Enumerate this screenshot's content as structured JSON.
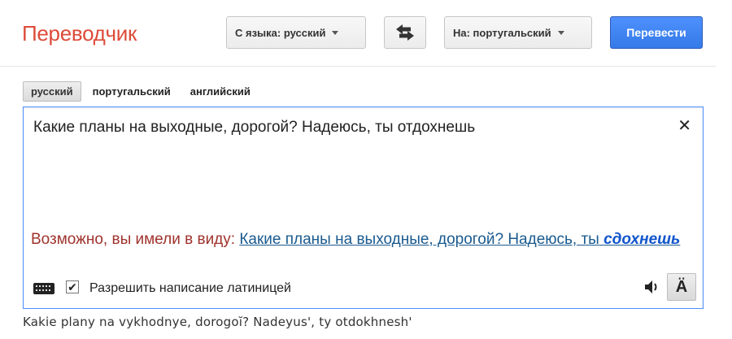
{
  "header": {
    "title": "Переводчик",
    "source_lang_button": "С языка: русский",
    "swap_icon": "swap-arrows-icon",
    "target_lang_button": "На: португальский",
    "translate_button": "Перевести"
  },
  "lang_tabs": [
    "русский",
    "португальский",
    "английский"
  ],
  "source": {
    "text": "Какие планы на выходные, дорогой? Надеюсь, ты отдохнешь",
    "clear_icon": "close-icon",
    "suggestion_prefix": "Возможно, вы имели в виду:",
    "suggestion_text": "Какие планы на выходные, дорогой? Надеюсь, ты",
    "suggestion_word": "сдохнешь",
    "keyboard_icon": "keyboard-icon",
    "checkbox_checked": true,
    "checkbox_label": "Разрешить написание латиницей",
    "speaker_icon": "speaker-icon",
    "accent_button": "Ä"
  },
  "transliteration": "Kakie plany na vykhodnye, dorogoĭ? Nadeyus', ty otdokhnesh'",
  "colors": {
    "title": "#dd4b39",
    "translate_button": "#4d90fe",
    "suggestion_prefix": "#a0332d",
    "suggestion_link": "#1a5a8f",
    "box_border": "#4d90fe"
  }
}
